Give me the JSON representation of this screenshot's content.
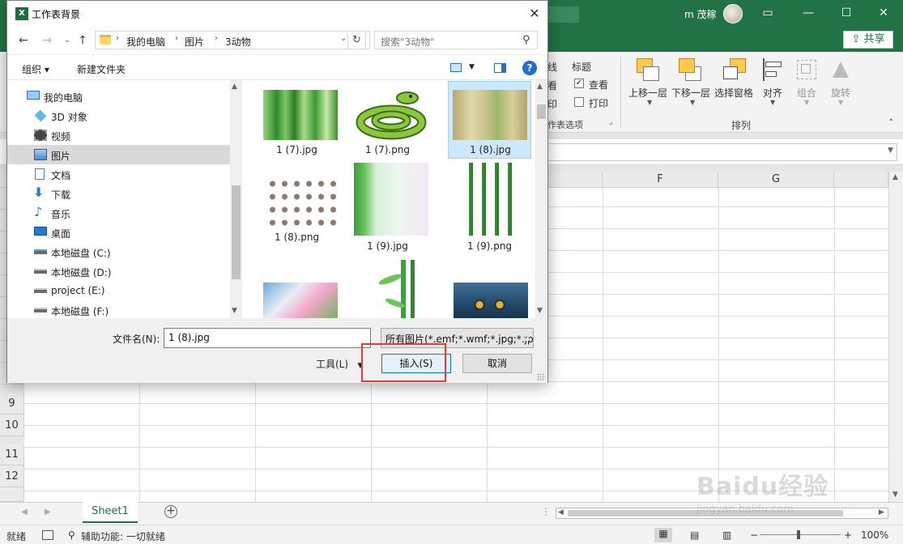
{
  "excel": {
    "user_name": "m 茂稼",
    "share_label": "共享",
    "ribbon": {
      "partial_labels": [
        "线",
        "看",
        "印"
      ],
      "title_label": "标题",
      "view_label": "查看",
      "print_label": "打印",
      "sheet_options_group": "作表选项",
      "arrange_group": "排列",
      "buttons": [
        "上移一层",
        "下移一层",
        "选择窗格",
        "对齐",
        "组合",
        "旋转"
      ]
    },
    "columns": [
      "F",
      "G"
    ],
    "rows": [
      "9",
      "10",
      "11",
      "12"
    ],
    "sheet_tab": "Sheet1",
    "status": {
      "ready": "就绪",
      "accessibility": "辅助功能: 一切就绪",
      "zoom": "100%"
    },
    "watermark": "Baidu经验",
    "watermark_sub": "jingyan.baidu.com"
  },
  "dialog": {
    "title": "工作表背景",
    "address": [
      "我的电脑",
      "图片",
      "3动物"
    ],
    "search_placeholder": "搜索\"3动物\"",
    "organize_label": "组织 ▾",
    "new_folder_label": "新建文件夹",
    "tree": [
      {
        "label": "我的电脑",
        "icon": "computer-icon"
      },
      {
        "label": "3D 对象",
        "icon": "3d-objects-icon"
      },
      {
        "label": "视频",
        "icon": "video-icon"
      },
      {
        "label": "图片",
        "icon": "pictures-icon",
        "selected": true
      },
      {
        "label": "文档",
        "icon": "documents-icon"
      },
      {
        "label": "下载",
        "icon": "downloads-icon"
      },
      {
        "label": "音乐",
        "icon": "music-icon"
      },
      {
        "label": "桌面",
        "icon": "desktop-icon"
      },
      {
        "label": "本地磁盘 (C:)",
        "icon": "drive-icon"
      },
      {
        "label": "本地磁盘 (D:)",
        "icon": "drive-icon"
      },
      {
        "label": "project (E:)",
        "icon": "drive-icon"
      },
      {
        "label": "本地磁盘 (F:)",
        "icon": "drive-icon"
      }
    ],
    "files": [
      {
        "name": "1 (7).jpg"
      },
      {
        "name": "1 (7).png"
      },
      {
        "name": "1 (8).jpg",
        "selected": true
      },
      {
        "name": "1 (8).png"
      },
      {
        "name": "1 (9).jpg"
      },
      {
        "name": "1 (9).png"
      },
      {
        "name": ""
      },
      {
        "name": ""
      },
      {
        "name": ""
      }
    ],
    "filename_label": "文件名(N):",
    "filename_value": "1 (8).jpg",
    "filter_value": "所有图片(*.emf;*.wmf;*.jpg;*.jp",
    "tools_label": "工具(L)",
    "insert_label": "插入(S)",
    "cancel_label": "取消"
  }
}
